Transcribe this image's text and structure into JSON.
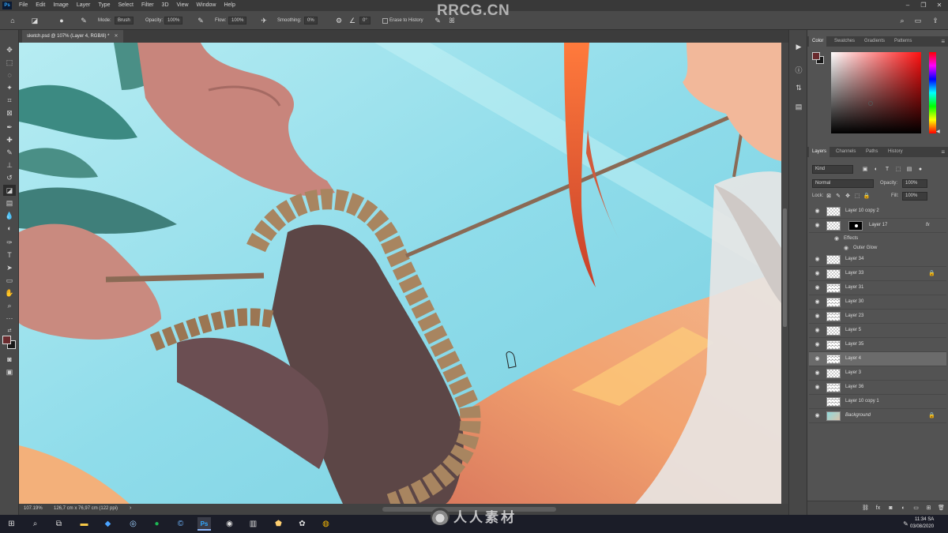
{
  "app": {
    "logo": "Ps",
    "watermark_top": "RRCG.CN",
    "watermark_bottom": "人人素材"
  },
  "menu": [
    "File",
    "Edit",
    "Image",
    "Layer",
    "Type",
    "Select",
    "Filter",
    "3D",
    "View",
    "Window",
    "Help"
  ],
  "options_bar": {
    "mode_label": "Mode:",
    "mode_value": "Brush",
    "opacity_label": "Opacity:",
    "opacity_value": "100%",
    "flow_label": "Flow:",
    "flow_value": "100%",
    "smoothing_label": "Smoothing:",
    "smoothing_value": "0%",
    "angle_value": "0°",
    "erase_history_label": "Erase to History"
  },
  "document": {
    "tab_title": "sketch.psd @ 107% (Layer 4, RGB/8) *"
  },
  "status_bar": {
    "zoom": "107.19%",
    "doc_info": "126,7 cm x 76,97 cm (122 ppi)",
    "arrow": "›"
  },
  "color_panel": {
    "tabs": [
      "Color",
      "Swatches",
      "Gradients",
      "Patterns"
    ],
    "active_tab": "Color",
    "foreground": "#6a2b2e",
    "background": "#1a1a1a"
  },
  "layers_panel": {
    "tabs": [
      "Layers",
      "Channels",
      "Paths",
      "History"
    ],
    "filter_kind": "Kind",
    "blend_mode": "Normal",
    "opacity_label": "Opacity:",
    "opacity_value": "100%",
    "lock_label": "Lock:",
    "fill_label": "Fill:",
    "fill_value": "100%",
    "effects_label": "Effects",
    "effect_name": "Outer Glow",
    "fx_label": "fx",
    "layers": [
      {
        "name": "Layer 10 copy 2"
      },
      {
        "name": "Layer 17"
      },
      {
        "name": "Layer 34"
      },
      {
        "name": "Layer 33"
      },
      {
        "name": "Layer 31"
      },
      {
        "name": "Layer 30"
      },
      {
        "name": "Layer 23"
      },
      {
        "name": "Layer 5"
      },
      {
        "name": "Layer 35"
      },
      {
        "name": "Layer 4"
      },
      {
        "name": "Layer 3"
      },
      {
        "name": "Layer 36"
      },
      {
        "name": "Layer 10 copy 1"
      },
      {
        "name": "Background"
      }
    ]
  },
  "taskbar": {
    "time": "11:34 SA",
    "date": "03/08/2020"
  }
}
